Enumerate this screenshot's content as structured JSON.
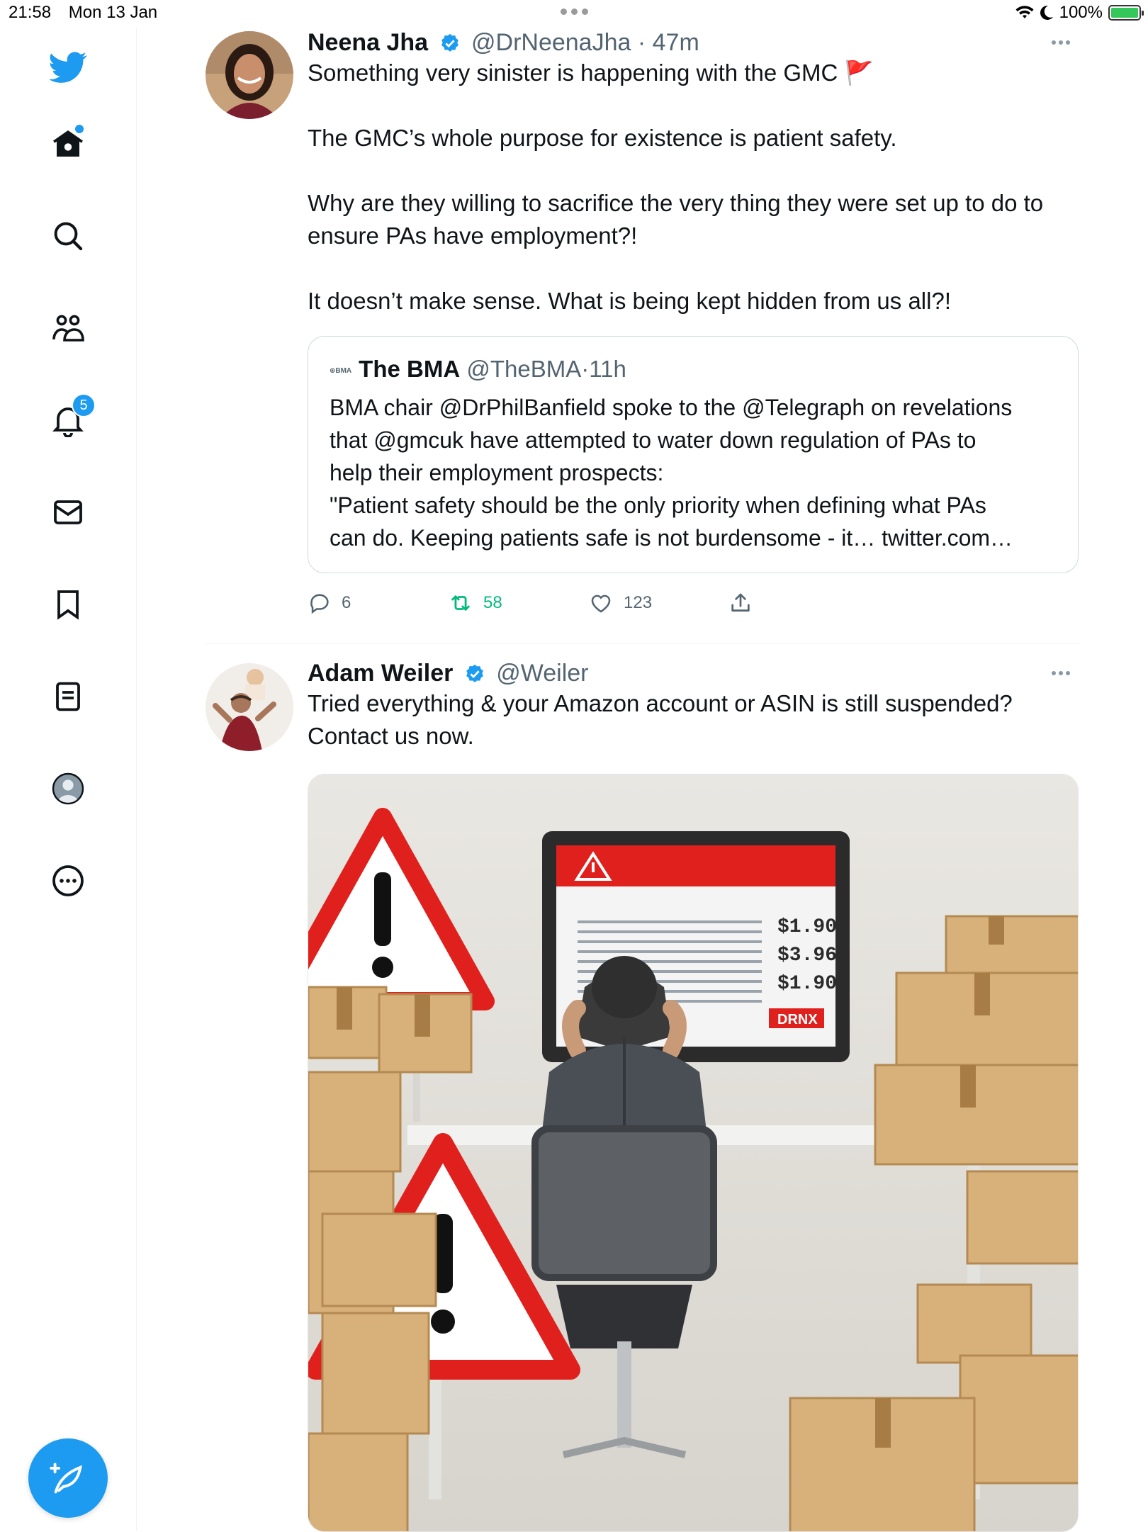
{
  "status_bar": {
    "time": "21:58",
    "date": "Mon 13 Jan",
    "battery": "100%",
    "battery_level": 1.0,
    "icons": [
      "wifi-icon",
      "moon-icon",
      "battery-charging-icon"
    ]
  },
  "sidebar": {
    "logo": "twitter-bird-icon",
    "items": [
      {
        "name": "home",
        "icon": "home-icon",
        "has_dot": true
      },
      {
        "name": "explore",
        "icon": "search-icon"
      },
      {
        "name": "communities",
        "icon": "people-icon"
      },
      {
        "name": "notifications",
        "icon": "bell-icon",
        "badge": "5"
      },
      {
        "name": "messages",
        "icon": "mail-icon"
      },
      {
        "name": "bookmarks",
        "icon": "bookmark-icon"
      },
      {
        "name": "lists",
        "icon": "list-icon"
      },
      {
        "name": "profile",
        "icon": "profile-avatar-icon"
      },
      {
        "name": "more",
        "icon": "more-circle-icon"
      }
    ],
    "compose_icon": "compose-feather-icon"
  },
  "tweets": [
    {
      "name": "Neena Jha",
      "handle": "@DrNeenaJha",
      "separator": "·",
      "time": "47m",
      "verified": true,
      "lines": [
        "Something very sinister is happening with the GMC 🚩",
        "The GMC’s whole purpose for existence is patient safety.",
        "Why are they willing to sacrifice the very thing they were set up to do to",
        "ensure PAs have employment?!",
        "It doesn’t make sense. What is being kept hidden from us all?!"
      ],
      "quote": {
        "logo_text": "⊕BMA",
        "name": "The BMA",
        "handle": "@TheBMA",
        "separator": "·",
        "time": "11h",
        "lines": [
          "BMA chair @DrPhilBanfield spoke to the @Telegraph on revelations",
          "that @gmcuk have attempted to water down regulation of PAs to",
          "help their employment prospects:",
          "\"Patient safety should be the only priority when defining what PAs",
          "can do. Keeping patients safe is not burdensome - it… twitter.com…"
        ]
      },
      "actions": {
        "replies": "6",
        "retweets": "58",
        "likes": "123"
      }
    },
    {
      "name": "Adam Weiler",
      "handle": "@Weiler",
      "verified": true,
      "lines": [
        "Tried everything & your Amazon account or ASIN is still suspended?",
        "Contact us now."
      ],
      "media": {
        "screen_prices": [
          "$1.90",
          "$3.96",
          "$1.90"
        ],
        "screen_tag": "DRNX"
      }
    }
  ],
  "colors": {
    "accent": "#1d9bf0",
    "retweet_green": "#00ba7c",
    "text_secondary": "#536471",
    "alert_red": "#e0201d"
  }
}
